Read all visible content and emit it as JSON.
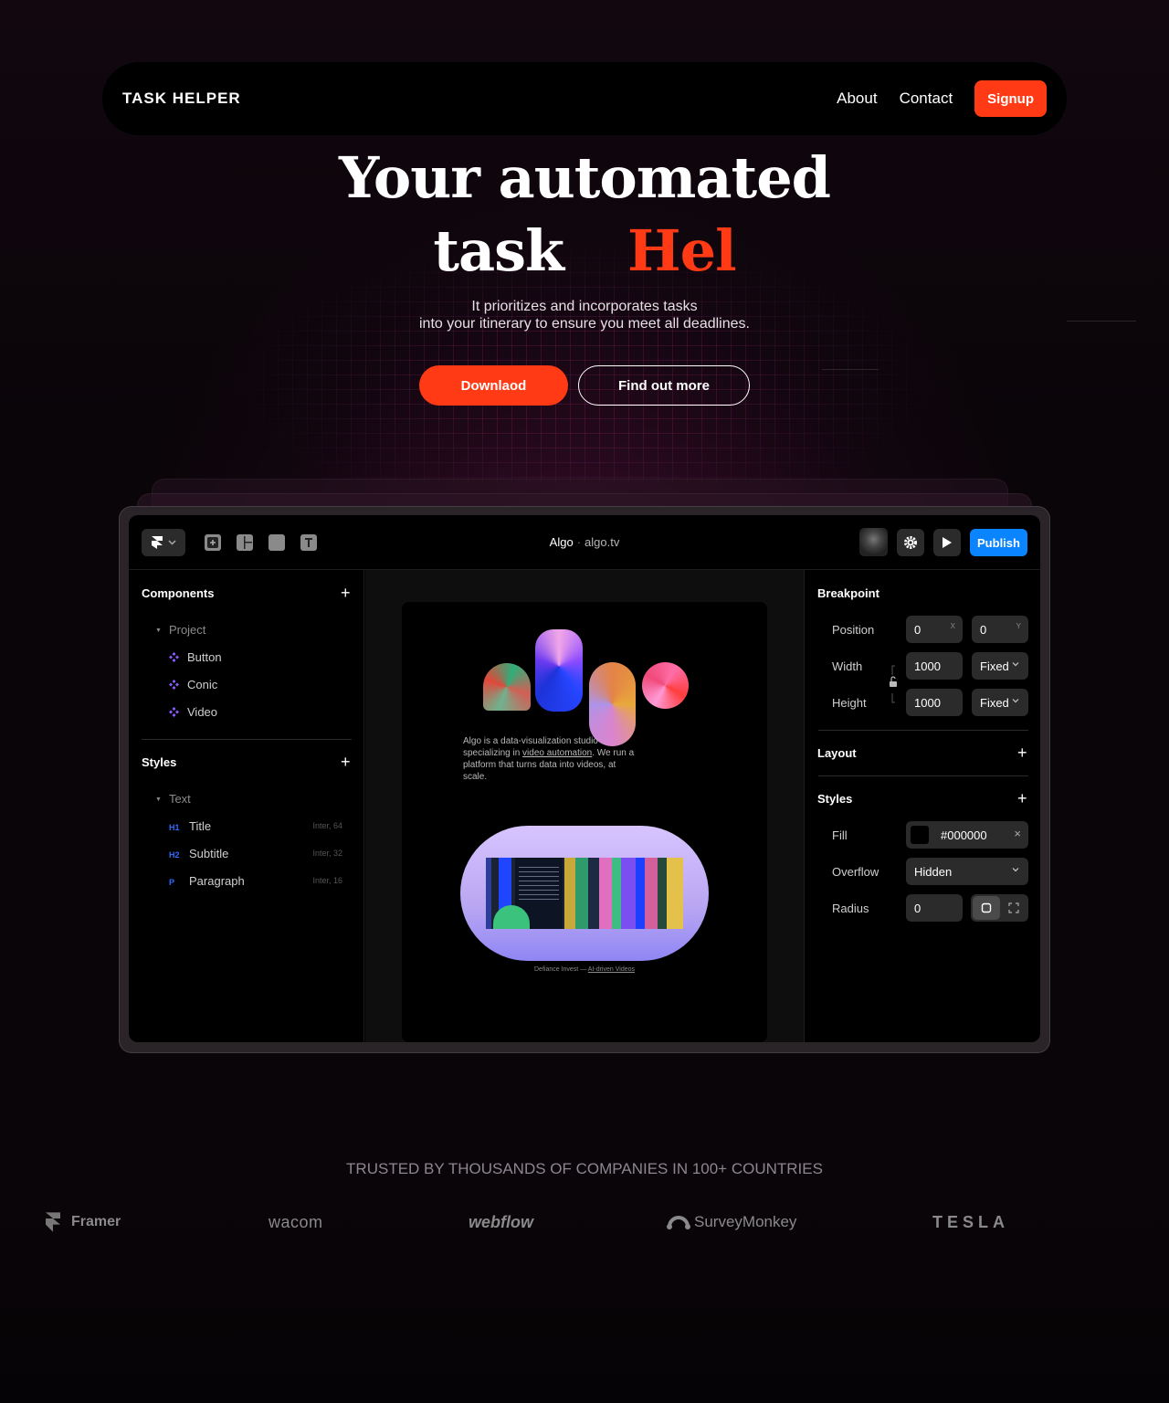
{
  "nav": {
    "brand": "TASK HELPER",
    "links": [
      "About",
      "Contact"
    ],
    "signup": "Signup"
  },
  "hero": {
    "title_line1": "Your automated",
    "title_line2_a": "task",
    "title_line2_b": "Hel",
    "subtitle_line1": "It prioritizes and incorporates tasks",
    "subtitle_line2": "into your itinerary to ensure you meet all deadlines.",
    "primary_button": "Downlaod",
    "secondary_button": "Find out more"
  },
  "app": {
    "project_name": "Algo",
    "domain": "algo.tv",
    "publish": "Publish",
    "left_panel": {
      "components_title": "Components",
      "project_label": "Project",
      "components": [
        "Button",
        "Conic",
        "Video"
      ],
      "styles_title": "Styles",
      "text_group": "Text",
      "styles": [
        {
          "tag": "H1",
          "name": "Title",
          "meta": "Inter, 64"
        },
        {
          "tag": "H2",
          "name": "Subtitle",
          "meta": "Inter, 32"
        },
        {
          "tag": "P",
          "name": "Paragraph",
          "meta": "Inter, 16"
        }
      ]
    },
    "canvas": {
      "text_a": "Algo is a data-visualization studio specializing in ",
      "link": "video automation",
      "text_b": ". We run a platform that turns data into videos, at scale.",
      "caption_a": "Defiance Invest — ",
      "caption_link": "AI-driven Videos"
    },
    "right_panel": {
      "breakpoint_title": "Breakpoint",
      "position_label": "Position",
      "position_x": "0",
      "position_y": "0",
      "x_suffix": "X",
      "y_suffix": "Y",
      "width_label": "Width",
      "width_value": "1000",
      "width_mode": "Fixed",
      "height_label": "Height",
      "height_value": "1000",
      "height_mode": "Fixed",
      "layout_title": "Layout",
      "styles_title": "Styles",
      "fill_label": "Fill",
      "fill_value": "#000000",
      "overflow_label": "Overflow",
      "overflow_value": "Hidden",
      "radius_label": "Radius",
      "radius_value": "0"
    }
  },
  "trusted": {
    "heading": "TRUSTED BY THOUSANDS OF COMPANIES IN 100+ COUNTRIES",
    "logos": [
      "Framer",
      "wacom",
      "webflow",
      "SurveyMonkey",
      "TESLA"
    ]
  },
  "colors": {
    "accent": "#ff3a14",
    "publish_blue": "#0a84ff",
    "background": "#0a0509"
  }
}
